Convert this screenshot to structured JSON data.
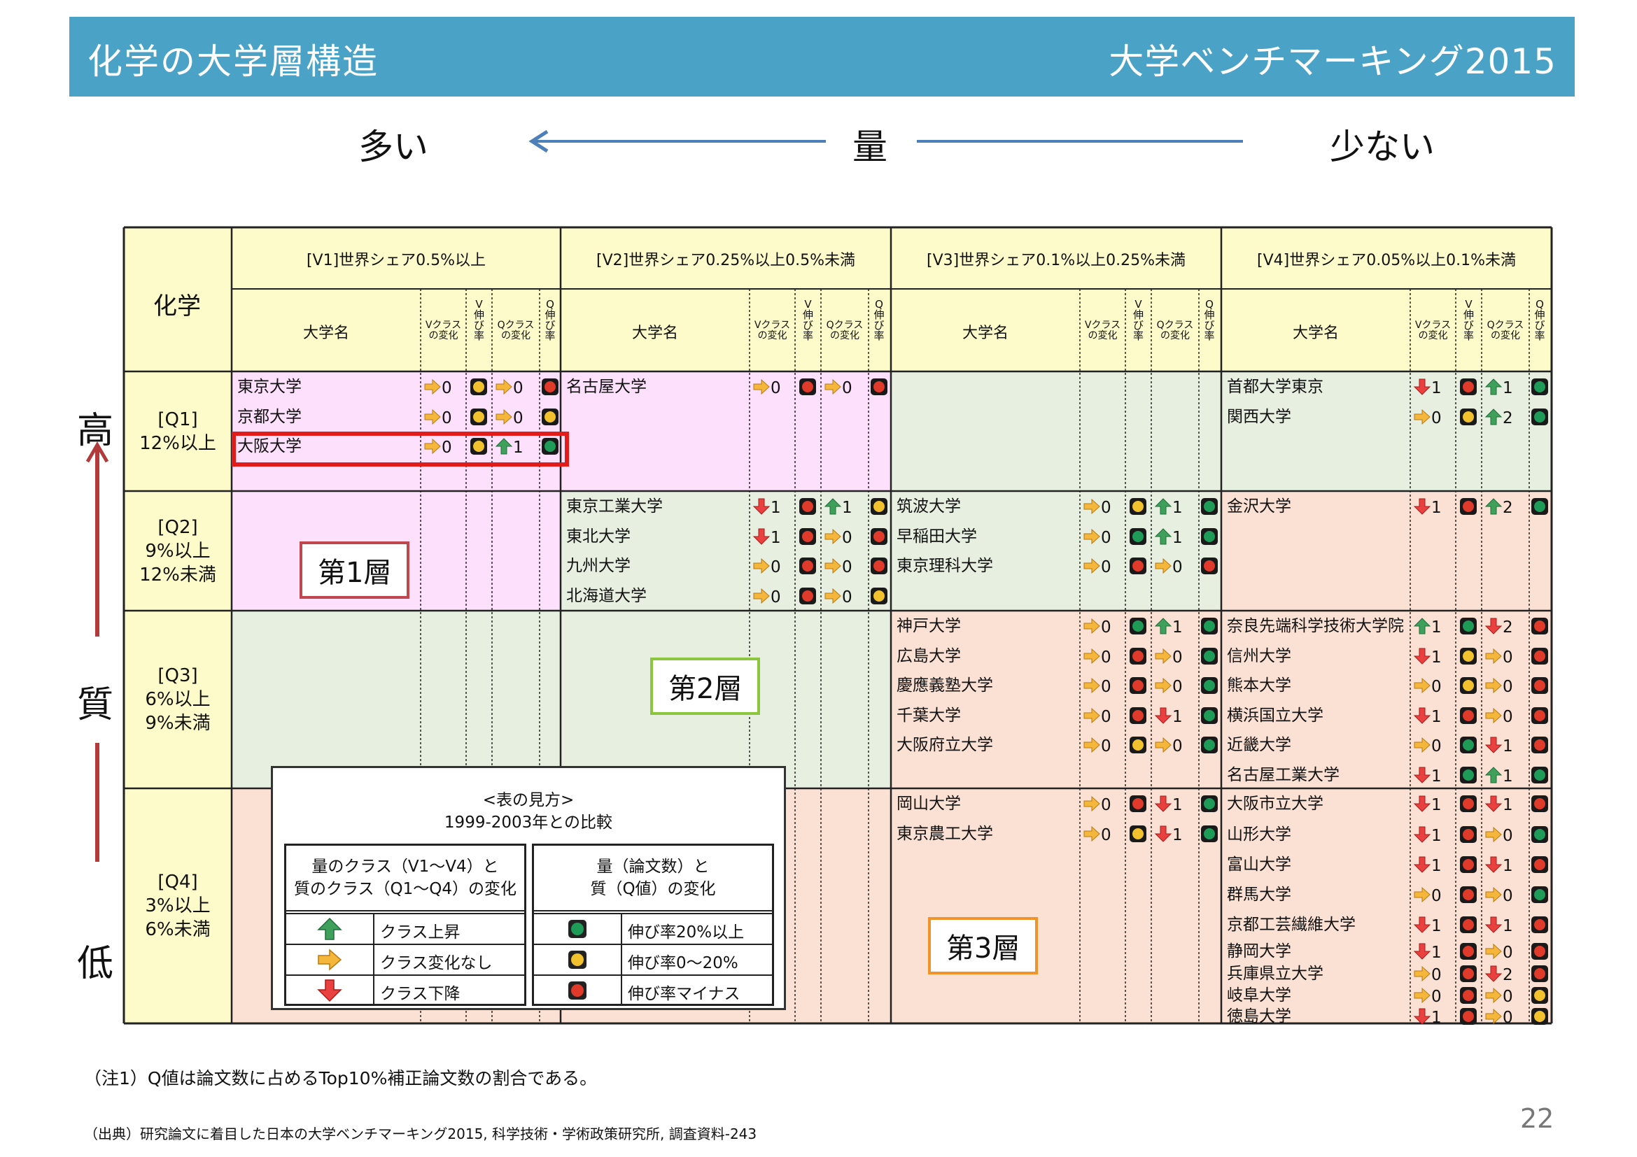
{
  "header": {
    "title": "化学の大学層構造",
    "brand": "大学ベンチマーキング2015"
  },
  "quantity_axis": {
    "more": "多い",
    "label": "量",
    "less": "少ない"
  },
  "quality_axis": {
    "high": "高",
    "label": "質",
    "low": "低"
  },
  "table": {
    "corner": "化学",
    "columns": [
      {
        "title": "[V1]世界シェア0.5%以上"
      },
      {
        "title": "[V2]世界シェア0.25%以上0.5%未満"
      },
      {
        "title": "[V3]世界シェア0.1%以上0.25%未満"
      },
      {
        "title": "[V4]世界シェア0.05%以上0.1%未満"
      }
    ],
    "sub_headers": {
      "name": "大学名",
      "v_class": [
        "Vクラス",
        "の変化"
      ],
      "v_rate": [
        "V",
        "伸",
        "び",
        "率"
      ],
      "q_class": [
        "Qクラス",
        "の変化"
      ],
      "q_rate": [
        "Q",
        "伸",
        "び",
        "率"
      ]
    },
    "rows": [
      {
        "label": [
          "[Q1]",
          "12%以上"
        ]
      },
      {
        "label": [
          "[Q2]",
          "9%以上",
          "12%未満"
        ]
      },
      {
        "label": [
          "[Q3]",
          "6%以上",
          "9%未満"
        ]
      },
      {
        "label": [
          "[Q4]",
          "3%以上",
          "6%未満"
        ]
      }
    ],
    "entries": [
      {
        "row": 0,
        "col": 0,
        "slot": 0,
        "name": "東京大学",
        "vc": "flat",
        "vcn": "0",
        "vr": "yellow",
        "qc": "flat",
        "qcn": "0",
        "qr": "red"
      },
      {
        "row": 0,
        "col": 0,
        "slot": 1,
        "name": "京都大学",
        "vc": "flat",
        "vcn": "0",
        "vr": "yellow",
        "qc": "flat",
        "qcn": "0",
        "qr": "yellow"
      },
      {
        "row": 0,
        "col": 0,
        "slot": 2,
        "name": "大阪大学",
        "vc": "flat",
        "vcn": "0",
        "vr": "yellow",
        "qc": "up",
        "qcn": "1",
        "qr": "green"
      },
      {
        "row": 0,
        "col": 1,
        "slot": 0,
        "name": "名古屋大学",
        "vc": "flat",
        "vcn": "0",
        "vr": "red",
        "qc": "flat",
        "qcn": "0",
        "qr": "red"
      },
      {
        "row": 0,
        "col": 3,
        "slot": 0,
        "name": "首都大学東京",
        "vc": "down",
        "vcn": "1",
        "vr": "red",
        "qc": "up",
        "qcn": "1",
        "qr": "green"
      },
      {
        "row": 0,
        "col": 3,
        "slot": 1,
        "name": "関西大学",
        "vc": "flat",
        "vcn": "0",
        "vr": "yellow",
        "qc": "up",
        "qcn": "2",
        "qr": "green"
      },
      {
        "row": 1,
        "col": 1,
        "slot": 0,
        "name": "東京工業大学",
        "vc": "down",
        "vcn": "1",
        "vr": "red",
        "qc": "up",
        "qcn": "1",
        "qr": "yellow"
      },
      {
        "row": 1,
        "col": 1,
        "slot": 1,
        "name": "東北大学",
        "vc": "down",
        "vcn": "1",
        "vr": "red",
        "qc": "flat",
        "qcn": "0",
        "qr": "red"
      },
      {
        "row": 1,
        "col": 1,
        "slot": 2,
        "name": "九州大学",
        "vc": "flat",
        "vcn": "0",
        "vr": "red",
        "qc": "flat",
        "qcn": "0",
        "qr": "red"
      },
      {
        "row": 1,
        "col": 1,
        "slot": 3,
        "name": "北海道大学",
        "vc": "flat",
        "vcn": "0",
        "vr": "red",
        "qc": "flat",
        "qcn": "0",
        "qr": "yellow"
      },
      {
        "row": 1,
        "col": 2,
        "slot": 0,
        "name": "筑波大学",
        "vc": "flat",
        "vcn": "0",
        "vr": "yellow",
        "qc": "up",
        "qcn": "1",
        "qr": "green"
      },
      {
        "row": 1,
        "col": 2,
        "slot": 1,
        "name": "早稲田大学",
        "vc": "flat",
        "vcn": "0",
        "vr": "green",
        "qc": "up",
        "qcn": "1",
        "qr": "green"
      },
      {
        "row": 1,
        "col": 2,
        "slot": 2,
        "name": "東京理科大学",
        "vc": "flat",
        "vcn": "0",
        "vr": "red",
        "qc": "flat",
        "qcn": "0",
        "qr": "red"
      },
      {
        "row": 1,
        "col": 3,
        "slot": 0,
        "name": "金沢大学",
        "vc": "down",
        "vcn": "1",
        "vr": "red",
        "qc": "up",
        "qcn": "2",
        "qr": "green"
      },
      {
        "row": 2,
        "col": 2,
        "slot": 0,
        "name": "神戸大学",
        "vc": "flat",
        "vcn": "0",
        "vr": "green",
        "qc": "up",
        "qcn": "1",
        "qr": "green"
      },
      {
        "row": 2,
        "col": 2,
        "slot": 1,
        "name": "広島大学",
        "vc": "flat",
        "vcn": "0",
        "vr": "red",
        "qc": "flat",
        "qcn": "0",
        "qr": "green"
      },
      {
        "row": 2,
        "col": 2,
        "slot": 2,
        "name": "慶應義塾大学",
        "vc": "flat",
        "vcn": "0",
        "vr": "red",
        "qc": "flat",
        "qcn": "0",
        "qr": "green"
      },
      {
        "row": 2,
        "col": 2,
        "slot": 3,
        "name": "千葉大学",
        "vc": "flat",
        "vcn": "0",
        "vr": "red",
        "qc": "down",
        "qcn": "1",
        "qr": "green"
      },
      {
        "row": 2,
        "col": 2,
        "slot": 4,
        "name": "大阪府立大学",
        "vc": "flat",
        "vcn": "0",
        "vr": "yellow",
        "qc": "flat",
        "qcn": "0",
        "qr": "green"
      },
      {
        "row": 2,
        "col": 3,
        "slot": 0,
        "name": "奈良先端科学技術大学院",
        "vc": "up",
        "vcn": "1",
        "vr": "green",
        "qc": "down",
        "qcn": "2",
        "qr": "red"
      },
      {
        "row": 2,
        "col": 3,
        "slot": 1,
        "name": "信州大学",
        "vc": "down",
        "vcn": "1",
        "vr": "yellow",
        "qc": "flat",
        "qcn": "0",
        "qr": "red"
      },
      {
        "row": 2,
        "col": 3,
        "slot": 2,
        "name": "熊本大学",
        "vc": "flat",
        "vcn": "0",
        "vr": "yellow",
        "qc": "flat",
        "qcn": "0",
        "qr": "red"
      },
      {
        "row": 2,
        "col": 3,
        "slot": 3,
        "name": "横浜国立大学",
        "vc": "down",
        "vcn": "1",
        "vr": "red",
        "qc": "flat",
        "qcn": "0",
        "qr": "red"
      },
      {
        "row": 2,
        "col": 3,
        "slot": 4,
        "name": "近畿大学",
        "vc": "flat",
        "vcn": "0",
        "vr": "green",
        "qc": "down",
        "qcn": "1",
        "qr": "red"
      },
      {
        "row": 2,
        "col": 3,
        "slot": 5,
        "name": "名古屋工業大学",
        "vc": "down",
        "vcn": "1",
        "vr": "green",
        "qc": "up",
        "qcn": "1",
        "qr": "green"
      },
      {
        "row": 3,
        "col": 2,
        "slot": 0,
        "name": "岡山大学",
        "vc": "flat",
        "vcn": "0",
        "vr": "red",
        "qc": "down",
        "qcn": "1",
        "qr": "green"
      },
      {
        "row": 3,
        "col": 2,
        "slot": 1,
        "name": "東京農工大学",
        "vc": "flat",
        "vcn": "0",
        "vr": "yellow",
        "qc": "down",
        "qcn": "1",
        "qr": "green"
      },
      {
        "row": 3,
        "col": 3,
        "slot": 0,
        "name": "大阪市立大学",
        "vc": "down",
        "vcn": "1",
        "vr": "red",
        "qc": "down",
        "qcn": "1",
        "qr": "red"
      },
      {
        "row": 3,
        "col": 3,
        "slot": 1,
        "name": "山形大学",
        "vc": "down",
        "vcn": "1",
        "vr": "red",
        "qc": "flat",
        "qcn": "0",
        "qr": "green"
      },
      {
        "row": 3,
        "col": 3,
        "slot": 2,
        "name": "富山大学",
        "vc": "down",
        "vcn": "1",
        "vr": "red",
        "qc": "down",
        "qcn": "1",
        "qr": "red"
      },
      {
        "row": 3,
        "col": 3,
        "slot": 3,
        "name": "群馬大学",
        "vc": "flat",
        "vcn": "0",
        "vr": "red",
        "qc": "flat",
        "qcn": "0",
        "qr": "green"
      },
      {
        "row": 3,
        "col": 3,
        "slot": 4,
        "name": "京都工芸繊維大学",
        "vc": "down",
        "vcn": "1",
        "vr": "red",
        "qc": "down",
        "qcn": "1",
        "qr": "red"
      },
      {
        "row": 3,
        "col": 3,
        "slot": 5,
        "name": "静岡大学",
        "vc": "down",
        "vcn": "1",
        "vr": "red",
        "qc": "flat",
        "qcn": "0",
        "qr": "red"
      },
      {
        "row": 3,
        "col": 3,
        "slot": 6,
        "name": "兵庫県立大学",
        "vc": "flat",
        "vcn": "0",
        "vr": "red",
        "qc": "down",
        "qcn": "2",
        "qr": "red"
      },
      {
        "row": 3,
        "col": 3,
        "slot": 7,
        "name": "岐阜大学",
        "vc": "flat",
        "vcn": "0",
        "vr": "red",
        "qc": "flat",
        "qcn": "0",
        "qr": "yellow"
      },
      {
        "row": 3,
        "col": 3,
        "slot": 8,
        "name": "徳島大学",
        "vc": "down",
        "vcn": "1",
        "vr": "red",
        "qc": "flat",
        "qcn": "0",
        "qr": "yellow"
      }
    ]
  },
  "layers": {
    "first": "第1層",
    "second": "第2層",
    "third": "第3層"
  },
  "legend": {
    "title": [
      "<表の見方>",
      "1999-2003年との比較"
    ],
    "class_header": [
      "量のクラス（V1～V4）と",
      "質のクラス（Q1～Q4）の変化"
    ],
    "class_items": [
      "クラス上昇",
      "クラス変化なし",
      "クラス下降"
    ],
    "rate_header": [
      "量（論文数）と",
      "質（Q値）の変化"
    ],
    "rate_items": [
      "伸び率20%以上",
      "伸び率0～20%",
      "伸び率マイナス"
    ]
  },
  "note": "（注1）Q値は論文数に占めるTop10%補正論文数の割合である。",
  "source": "（出典）研究論文に着目した日本の大学ベンチマーキング2015, 科学技術・学術政策研究所, 調査資料-243",
  "page_number": "22",
  "colors": {
    "header_bg": "#4aa3c6",
    "pink": "#fde0fb",
    "green_zone": "#e6efe0",
    "salmon": "#fbe1d4",
    "cream": "#fdfbc9",
    "layer1": "#c0474e",
    "layer2": "#8cc63f",
    "layer3": "#f0932b",
    "lamp_green": "#1e9b57",
    "lamp_yellow": "#f2c12e",
    "lamp_red": "#e03a2b",
    "arrow_up": "#3fa05c",
    "arrow_flat": "#f4b73b",
    "arrow_down": "#e8413f"
  }
}
